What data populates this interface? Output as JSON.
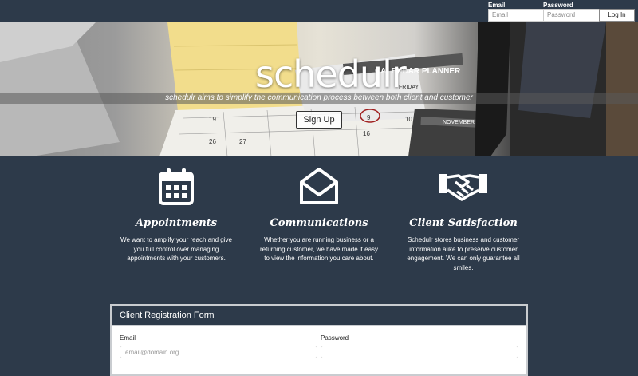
{
  "topbar": {
    "email_label": "Email",
    "email_placeholder": "Email",
    "password_label": "Password",
    "password_placeholder": "Password",
    "login_label": "Log In"
  },
  "hero": {
    "title": "schedulr",
    "tagline": "schedulr aims to simplify the communication process between both client and customer",
    "signup_label": "Sign Up",
    "image_text": {
      "planner": "CALENDAR PLANNER",
      "friday": "FRIDAY",
      "november": "NOVEMBER",
      "day_9": "9",
      "day_10": "10",
      "day_16": "16",
      "day_19": "19",
      "day_26": "26",
      "day_27": "27"
    }
  },
  "features": [
    {
      "icon": "calendar-icon",
      "title": "Appointments",
      "text": "We want to amplify your reach and give you full control over managing appointments with your customers."
    },
    {
      "icon": "envelope-icon",
      "title": "Communications",
      "text": "Whether you are running business or a returning customer, we have made it easy to view the information you care about."
    },
    {
      "icon": "handshake-icon",
      "title": "Client Satisfaction",
      "text": "Schedulr stores business and customer information alike to preserve customer engagement. We can only guarantee all smiles."
    }
  ],
  "form": {
    "title": "Client Registration Form",
    "email_label": "Email",
    "email_placeholder": "email@domain.org",
    "password_label": "Password",
    "password_placeholder": ""
  }
}
